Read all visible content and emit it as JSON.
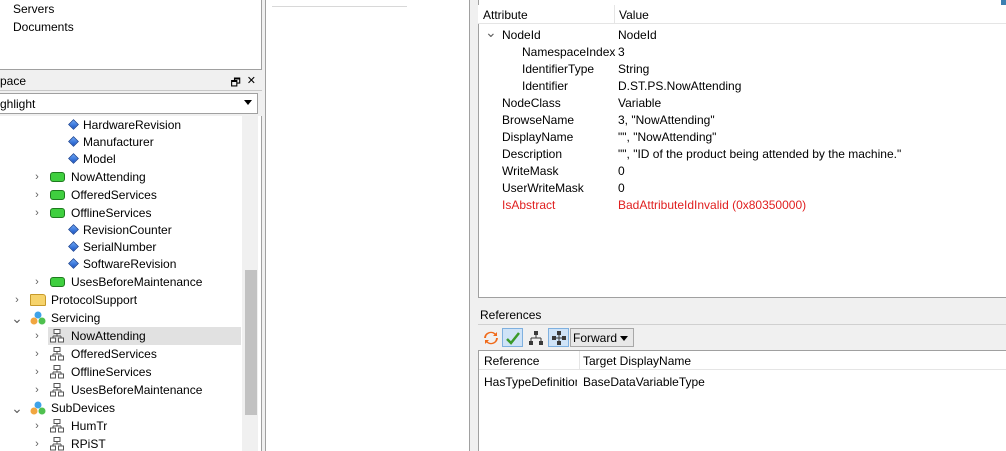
{
  "top_tree": [
    {
      "label": "Servers"
    },
    {
      "label": "Documents"
    }
  ],
  "workspace": {
    "title": "pace",
    "float_btn": "🗗",
    "close_btn": "✕",
    "filter_value": "ghlight"
  },
  "tree": [
    {
      "label": "HardwareRevision",
      "icon": "property-icon",
      "chevron": ""
    },
    {
      "label": "Manufacturer",
      "icon": "property-icon",
      "chevron": ""
    },
    {
      "label": "Model",
      "icon": "property-icon",
      "chevron": ""
    },
    {
      "label": "NowAttending",
      "icon": "object-icon",
      "chevron": ">"
    },
    {
      "label": "OfferedServices",
      "icon": "object-icon",
      "chevron": ">"
    },
    {
      "label": "OfflineServices",
      "icon": "object-icon",
      "chevron": ">"
    },
    {
      "label": "RevisionCounter",
      "icon": "property-icon",
      "chevron": ""
    },
    {
      "label": "SerialNumber",
      "icon": "property-icon",
      "chevron": ""
    },
    {
      "label": "SoftwareRevision",
      "icon": "property-icon",
      "chevron": ""
    },
    {
      "label": "UsesBeforeMaintenance",
      "icon": "object-icon",
      "chevron": ">"
    },
    {
      "label": "ProtocolSupport",
      "icon": "folder-icon",
      "chevron": ">"
    },
    {
      "label": "Servicing",
      "icon": "objects-group-icon",
      "chevron": "v"
    },
    {
      "label": "NowAttending",
      "icon": "reference-icon",
      "chevron": ">",
      "selected": true
    },
    {
      "label": "OfferedServices",
      "icon": "reference-icon",
      "chevron": ">"
    },
    {
      "label": "OfflineServices",
      "icon": "reference-icon",
      "chevron": ">"
    },
    {
      "label": "UsesBeforeMaintenance",
      "icon": "reference-icon",
      "chevron": ">"
    },
    {
      "label": "SubDevices",
      "icon": "objects-group-icon",
      "chevron": "v"
    },
    {
      "label": "HumTr",
      "icon": "reference-icon",
      "chevron": ">"
    },
    {
      "label": "RPiST",
      "icon": "reference-icon",
      "chevron": ">"
    }
  ],
  "attributes": {
    "header_attribute": "Attribute",
    "header_value": "Value",
    "rows": [
      {
        "name": "NodeId",
        "value": "NodeId",
        "chevron": "v"
      },
      {
        "name": "NamespaceIndex",
        "value": "3"
      },
      {
        "name": "IdentifierType",
        "value": "String"
      },
      {
        "name": "Identifier",
        "value": "D.ST.PS.NowAttending"
      },
      {
        "name": "NodeClass",
        "value": "Variable"
      },
      {
        "name": "BrowseName",
        "value": "3, \"NowAttending\""
      },
      {
        "name": "DisplayName",
        "value": "\"\", \"NowAttending\""
      },
      {
        "name": "Description",
        "value": "\"\", \"ID of the product being attended by the machine.\""
      },
      {
        "name": "WriteMask",
        "value": "0"
      },
      {
        "name": "UserWriteMask",
        "value": "0"
      },
      {
        "name": "IsAbstract",
        "value": "BadAttributeIdInvalid (0x80350000)",
        "error": true
      }
    ]
  },
  "references": {
    "title": "References",
    "direction_value": "Forward",
    "header_reference": "Reference",
    "header_target": "Target DisplayName",
    "rows": [
      {
        "reference": "HasTypeDefinition",
        "target": "BaseDataVariableType"
      }
    ]
  },
  "colors": {
    "error": "#e02020",
    "selection": "#e1e1e1",
    "accent": "#3c7fb1"
  }
}
